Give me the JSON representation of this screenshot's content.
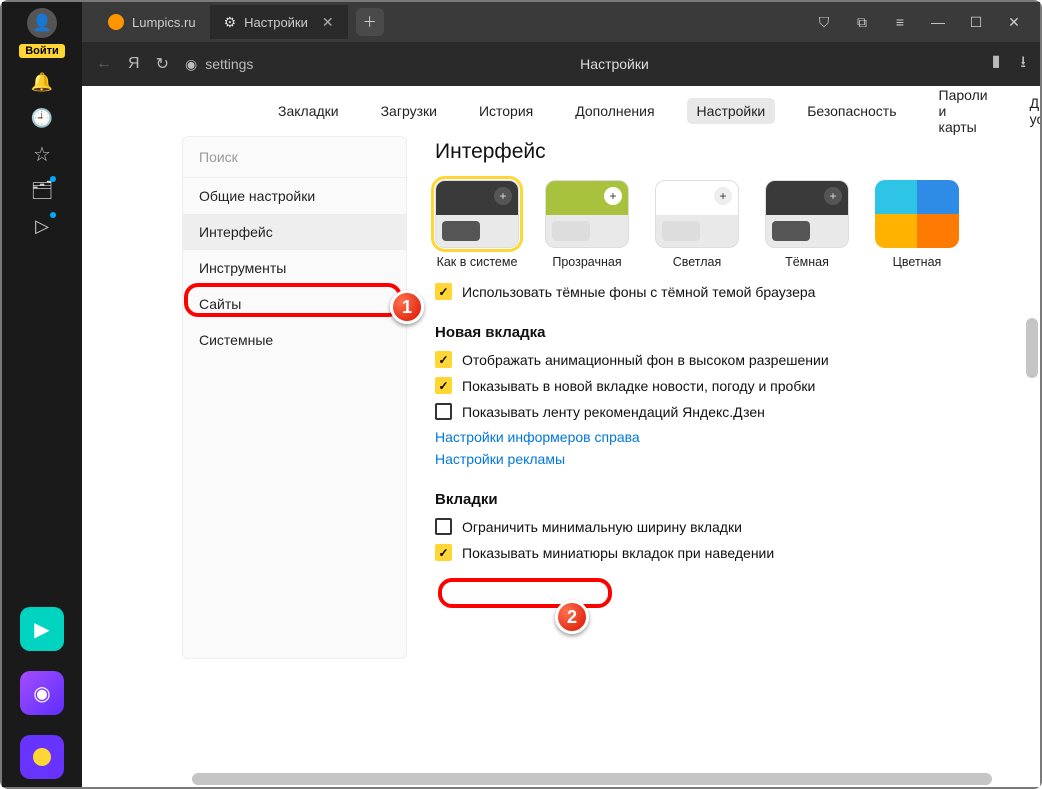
{
  "os": {
    "login": "Войти"
  },
  "tabs": {
    "t1": "Lumpics.ru",
    "t2": "Настройки"
  },
  "addr": {
    "url": "settings",
    "title": "Настройки"
  },
  "topnav": [
    "Закладки",
    "Загрузки",
    "История",
    "Дополнения",
    "Настройки",
    "Безопасность",
    "Пароли и карты",
    "Другие ус"
  ],
  "sidebar": {
    "search": "Поиск",
    "items": [
      "Общие настройки",
      "Интерфейс",
      "Инструменты",
      "Сайты",
      "Системные"
    ]
  },
  "main": {
    "h1": "Интерфейс",
    "themes": [
      "Как в системе",
      "Прозрачная",
      "Светлая",
      "Тёмная",
      "Цветная"
    ],
    "chk_dark": "Использовать тёмные фоны с тёмной темой браузера",
    "h2a": "Новая вкладка",
    "chk_anim": "Отображать анимационный фон в высоком разрешении",
    "chk_news": "Показывать в новой вкладке новости, погоду и пробки",
    "chk_zen": "Показывать ленту рекомендаций Яндекс.Дзен",
    "link_inf": "Настройки информеров справа",
    "link_ads": "Настройки рекламы",
    "h2b": "Вкладки",
    "chk_minw": "Ограничить минимальную ширину вкладки",
    "chk_thumb": "Показывать миниатюры вкладок при наведении"
  },
  "badges": {
    "n1": "1",
    "n2": "2"
  }
}
